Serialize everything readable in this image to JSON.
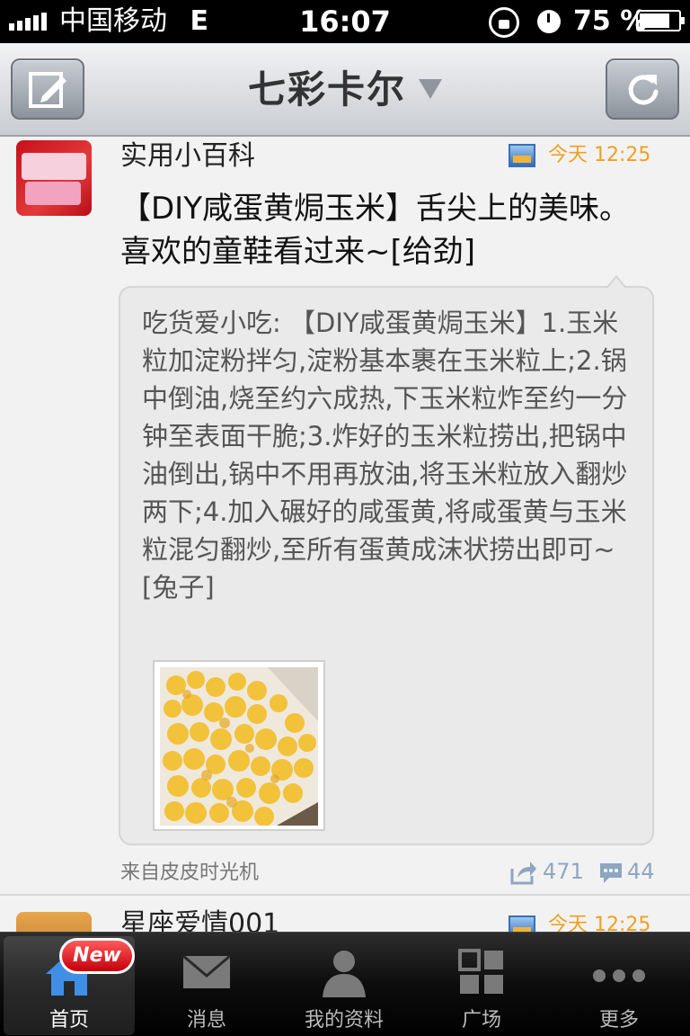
{
  "status_bar": {
    "carrier": "中国移动",
    "network": "E",
    "time": "16:07",
    "battery": "75 %",
    "signal_bars": 5,
    "battery_level": 0.75
  },
  "nav": {
    "title": "七彩卡尔",
    "compose_icon": "compose-icon",
    "refresh_icon": "refresh-icon"
  },
  "posts": [
    {
      "user": "实用小百科",
      "time": "今天  12:25",
      "text": "【DIY咸蛋黄焗玉米】舌尖上的美味。喜欢的童鞋看过来~[给劲]",
      "repost": {
        "text": "吃货爱小吃: 【DIY咸蛋黄焗玉米】1.玉米粒加淀粉拌匀,淀粉基本裹在玉米粒上;2.锅中倒油,烧至约六成热,下玉米粒炸至约一分钟至表面干脆;3.炸好的玉米粒捞出,把锅中油倒出,锅中不用再放油,将玉米粒放入翻炒两下;4.加入碾好的咸蛋黄,将咸蛋黄与玉米粒混匀翻炒,至所有蛋黄成沫状捞出即可~[兔子]"
      },
      "source": "来自皮皮时光机",
      "reposts": "471",
      "comments": "44"
    },
    {
      "user": "星座爱情001",
      "time": "今天  12:25"
    }
  ],
  "tabs": [
    {
      "label": "首页",
      "icon": "home-icon",
      "badge": "New"
    },
    {
      "label": "消息",
      "icon": "mail-icon"
    },
    {
      "label": "我的资料",
      "icon": "profile-icon"
    },
    {
      "label": "广场",
      "icon": "square-icon"
    },
    {
      "label": "更多",
      "icon": "more-icon"
    }
  ],
  "colors": {
    "accent_time": "#f0a020",
    "count_blue": "#8ea6c2",
    "badge_red": "#d8101a"
  }
}
